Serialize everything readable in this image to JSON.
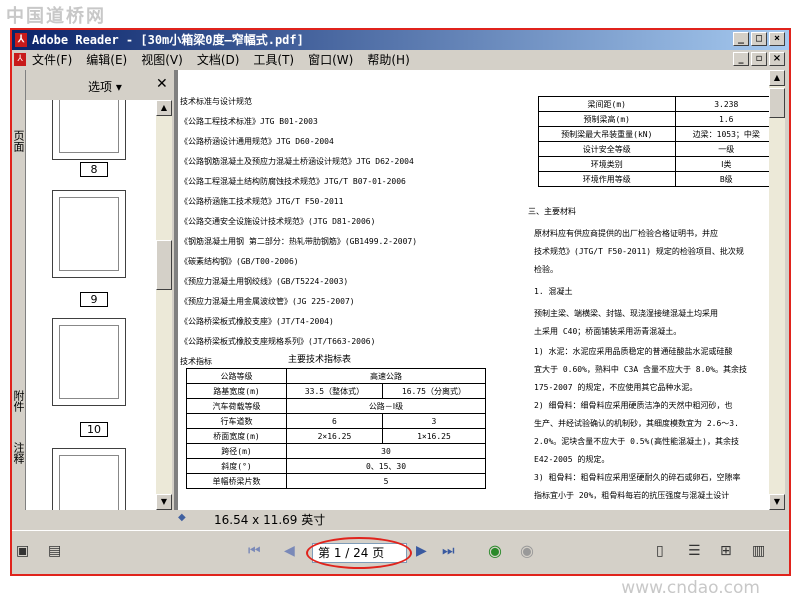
{
  "watermark": {
    "top": "中国道桥网",
    "bottom": "www.cndao.com"
  },
  "window": {
    "title": "Adobe Reader - [30m小箱梁0度—窄幅式.pdf]",
    "menu": [
      "文件(F)",
      "编辑(E)",
      "视图(V)",
      "文档(D)",
      "工具(T)",
      "窗口(W)",
      "帮助(H)"
    ]
  },
  "nav": {
    "options": "选项 ▾",
    "close": "✕",
    "tabs": [
      "页面",
      "附件",
      "注释"
    ],
    "pages": [
      "8",
      "9",
      "10"
    ]
  },
  "doc": {
    "left_lines": [
      "技术标准与设计规范",
      "《公路工程技术标准》JTG B01-2003",
      "《公路桥涵设计通用规范》JTG D60-2004",
      "《公路钢筋混凝土及预应力混凝土桥涵设计规范》JTG D62-2004",
      "《公路工程混凝土结构防腐蚀技术规范》JTG/T B07-01-2006",
      "《公路桥涵施工技术规范》JTG/T F50-2011",
      "《公路交通安全设施设计技术规范》(JTG D81-2006)",
      "《钢筋混凝土用钢 第二部分：热轧带肋钢筋》(GB1499.2-2007)",
      "《碳素结构钢》(GB/T00-2006)",
      "《预应力混凝土用钢绞线》(GB/T5224-2003)",
      "《预应力混凝土用金属波纹管》(JG 225-2007)",
      "《公路桥梁板式橡胶支座》(JT/T4-2004)",
      "《公路桥梁板式橡胶支座规格系列》(JT/T663-2006)",
      "技术指标"
    ],
    "table_title": "主要技术指标表",
    "table": [
      [
        "公路等级",
        "高速公路",
        ""
      ],
      [
        "路基宽度(m)",
        "33.5（整体式）",
        "16.75（分离式）"
      ],
      [
        "汽车荷载等级",
        "公路－Ⅰ级",
        ""
      ],
      [
        "行车道数",
        "6",
        "3"
      ],
      [
        "桥面宽度(m)",
        "2×16.25",
        "1×16.25"
      ],
      [
        "跨径(m)",
        "30",
        ""
      ],
      [
        "斜度(°)",
        "0、15、30",
        ""
      ],
      [
        "单幅桥梁片数",
        "5",
        ""
      ]
    ],
    "right_table": [
      [
        "梁间距(m)",
        "3.238"
      ],
      [
        "预制梁高(m)",
        "1.6"
      ],
      [
        "预制梁最大吊装重量(kN)",
        "边梁：1053；中梁"
      ],
      [
        "设计安全等级",
        "一级"
      ],
      [
        "环境类别",
        "Ⅰ类"
      ],
      [
        "环境作用等级",
        "B级"
      ]
    ],
    "right_lines": [
      "三、主要材料",
      "原材料应有供应商提供的出厂检验合格证明书，并应",
      "技术规范》(JTG/T F50-2011) 规定的检验项目、批次规",
      "检验。",
      "1. 混凝土",
      "预制主梁、端横梁、封锚、现浇湿接缝混凝土均采用",
      "土采用 C40；桥面铺装采用沥青混凝土。",
      "1) 水泥：水泥应采用品质稳定的普通硅酸盐水泥或硅酸",
      "宜大于 0.60%，熟料中 C3A 含量不应大于 8.0%。其余技",
      "175-2007 的规定，不应使用其它品种水泥。",
      "2) 细骨料：细骨料应采用硬质洁净的天然中粗河砂，也",
      "生产、并经试验确认的机制砂，其细度模数宜为 2.6～3.",
      "2.0%。泥块含量不应大于 0.5%(高性能混凝土)，其余技",
      "E42-2005 的规定。",
      "3) 粗骨料：粗骨料应采用坚硬耐久的碎石或卵石，空隙率",
      "指标宜小于 20%，粗骨料每岩的抗压强度与混凝土设计"
    ]
  },
  "status": {
    "size": "16.54 x 11.69 英寸"
  },
  "pager": {
    "text": "第 1 / 24 页"
  }
}
